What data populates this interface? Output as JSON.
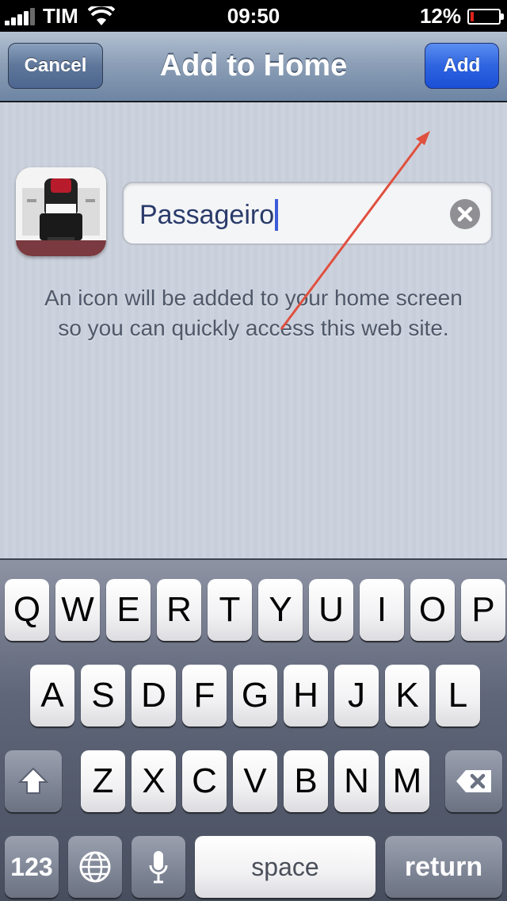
{
  "status_bar": {
    "carrier": "TIM",
    "time": "09:50",
    "battery_percent": "12%",
    "battery_level": 0.12,
    "icons": [
      "signal-icon",
      "wifi-icon",
      "battery-icon"
    ]
  },
  "nav": {
    "title": "Add to Home",
    "cancel_label": "Cancel",
    "add_label": "Add"
  },
  "content": {
    "name_value": "Passageiro",
    "help_text_line1": "An icon will be added to your home screen",
    "help_text_line2": "so you can quickly access this web site."
  },
  "keyboard": {
    "row1": [
      "Q",
      "W",
      "E",
      "R",
      "T",
      "Y",
      "U",
      "I",
      "O",
      "P"
    ],
    "row2": [
      "A",
      "S",
      "D",
      "F",
      "G",
      "H",
      "J",
      "K",
      "L"
    ],
    "row3": [
      "Z",
      "X",
      "C",
      "V",
      "B",
      "N",
      "M"
    ],
    "numbers_label": "123",
    "space_label": "space",
    "return_label": "return"
  },
  "colors": {
    "add_button": "#2e64e0",
    "annotation_arrow": "#e0503f",
    "battery_low": "#e2231a"
  }
}
